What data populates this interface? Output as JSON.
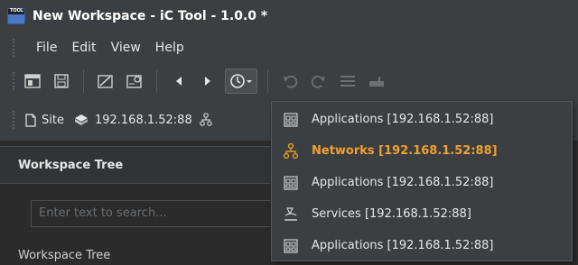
{
  "window": {
    "title": "New Workspace - iC Tool - 1.0.0 *",
    "app_icon_text": "TOOL"
  },
  "menu": [
    "File",
    "Edit",
    "View",
    "Help"
  ],
  "address": {
    "site_label": "Site",
    "device_label": "192.168.1.52:88"
  },
  "panel": {
    "title": "Workspace Tree",
    "search_placeholder": "Enter text to search...",
    "tree_label": "Workspace Tree"
  },
  "history_menu": [
    {
      "label": "Applications [192.168.1.52:88]",
      "icon": "applications-icon",
      "highlight": false
    },
    {
      "label": "Networks [192.168.1.52:88]",
      "icon": "networks-icon",
      "highlight": true
    },
    {
      "label": "Applications [192.168.1.52:88]",
      "icon": "applications-icon",
      "highlight": false
    },
    {
      "label": "Services [192.168.1.52:88]",
      "icon": "services-icon",
      "highlight": false
    },
    {
      "label": "Applications [192.168.1.52:88]",
      "icon": "applications-icon",
      "highlight": false
    }
  ],
  "colors": {
    "highlight": "#f0a030",
    "networks_icon": "#e0a020",
    "background": "#3c3f41"
  }
}
